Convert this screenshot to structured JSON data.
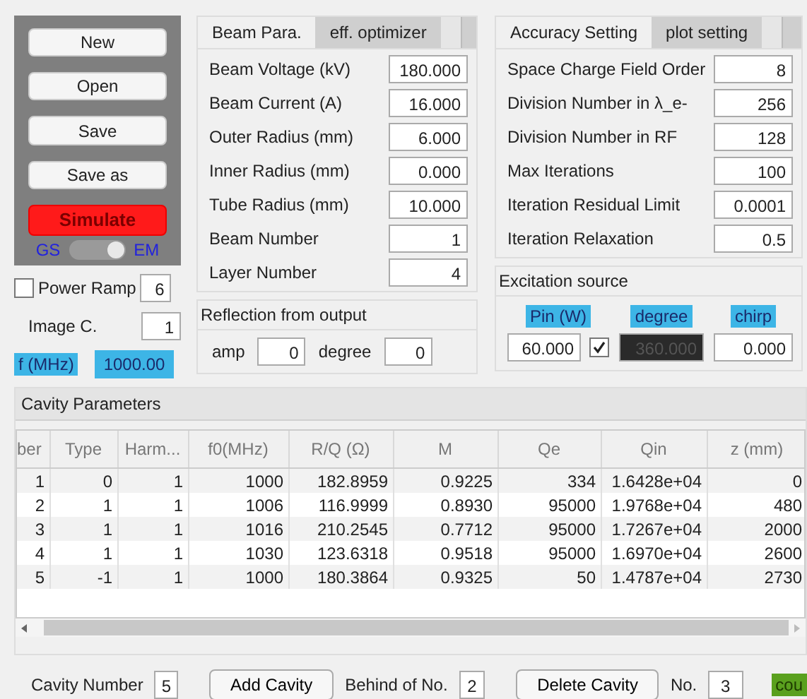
{
  "file_buttons": [
    {
      "label": "New",
      "kind": "plain"
    },
    {
      "label": "Open",
      "kind": "plain"
    },
    {
      "label": "Save",
      "kind": "plain"
    },
    {
      "label": "Save as",
      "kind": "plain"
    },
    {
      "label": "Simulate",
      "kind": "run"
    }
  ],
  "mode_switch": {
    "left": "GS",
    "right": "EM",
    "on": true
  },
  "power_ramp": {
    "label": "Power Ramp",
    "checked": false,
    "value": "6"
  },
  "image_c": {
    "label": "Image C.",
    "value": "1"
  },
  "frequency": {
    "label": "f (MHz)",
    "value": "1000.00"
  },
  "beam_tabs": [
    {
      "label": "Beam Para.",
      "selected": true
    },
    {
      "label": "eff. optimizer",
      "selected": false
    }
  ],
  "beam_fields": [
    {
      "label": "Beam Voltage (kV)",
      "value": "180.000"
    },
    {
      "label": "Beam Current (A)",
      "value": "16.000"
    },
    {
      "label": "Outer Radius (mm)",
      "value": "6.000"
    },
    {
      "label": "Inner Radius (mm)",
      "value": "0.000"
    },
    {
      "label": "Tube Radius (mm)",
      "value": "10.000"
    },
    {
      "label": "Beam Number",
      "value": "1"
    },
    {
      "label": "Layer Number",
      "value": "4"
    }
  ],
  "reflection": {
    "title": "Reflection from output",
    "fields": [
      {
        "label": "amp",
        "value": "0"
      },
      {
        "label": "degree",
        "value": "0"
      }
    ]
  },
  "accuracy_tabs": [
    {
      "label": "Accuracy Setting",
      "selected": true
    },
    {
      "label": "plot setting",
      "selected": false
    }
  ],
  "accuracy_fields": [
    {
      "label": "Space Charge Field Order",
      "value": "8"
    },
    {
      "label": "Division Number in λ_e-",
      "value": "256"
    },
    {
      "label": "Division Number in RF",
      "value": "128"
    },
    {
      "label": "Max Iterations",
      "value": "100"
    },
    {
      "label": "Iteration Residual Limit",
      "value": "0.0001"
    },
    {
      "label": "Iteration Relaxation",
      "value": "0.5"
    }
  ],
  "excitation": {
    "title": "Excitation source",
    "pin_label": "Pin (W)",
    "pin_value": "60.000",
    "pin_checked": true,
    "degree_label": "degree",
    "degree_value": "360.000",
    "degree_disabled": true,
    "chirp_label": "chirp",
    "chirp_value": "0.000"
  },
  "cavity": {
    "title": "Cavity Parameters",
    "columns": [
      "ber",
      "Type",
      "Harm...",
      "f0(MHz)",
      "R/Q (Ω)",
      "M",
      "Qe",
      "Qin",
      "z (mm)"
    ],
    "rows": [
      [
        "1",
        "0",
        "1",
        "1000",
        "182.8959",
        "0.9225",
        "334",
        "1.6428e+04",
        "0"
      ],
      [
        "2",
        "1",
        "1",
        "1006",
        "116.9999",
        "0.8930",
        "95000",
        "1.9768e+04",
        "480"
      ],
      [
        "3",
        "1",
        "1",
        "1016",
        "210.2545",
        "0.7712",
        "95000",
        "1.7267e+04",
        "2000"
      ],
      [
        "4",
        "1",
        "1",
        "1030",
        "123.6318",
        "0.9518",
        "95000",
        "1.6970e+04",
        "2600"
      ],
      [
        "5",
        "-1",
        "1",
        "1000",
        "180.3864",
        "0.9325",
        "50",
        "1.4787e+04",
        "2730"
      ]
    ]
  },
  "cavity_controls": {
    "count_label": "Cavity Number",
    "count": "5",
    "add_button": "Add Cavity",
    "behind_label": "Behind of No.",
    "behind_value": "2",
    "delete_button": "Delete Cavity",
    "no_label": "No.",
    "no_value": "3",
    "status": "cou"
  }
}
